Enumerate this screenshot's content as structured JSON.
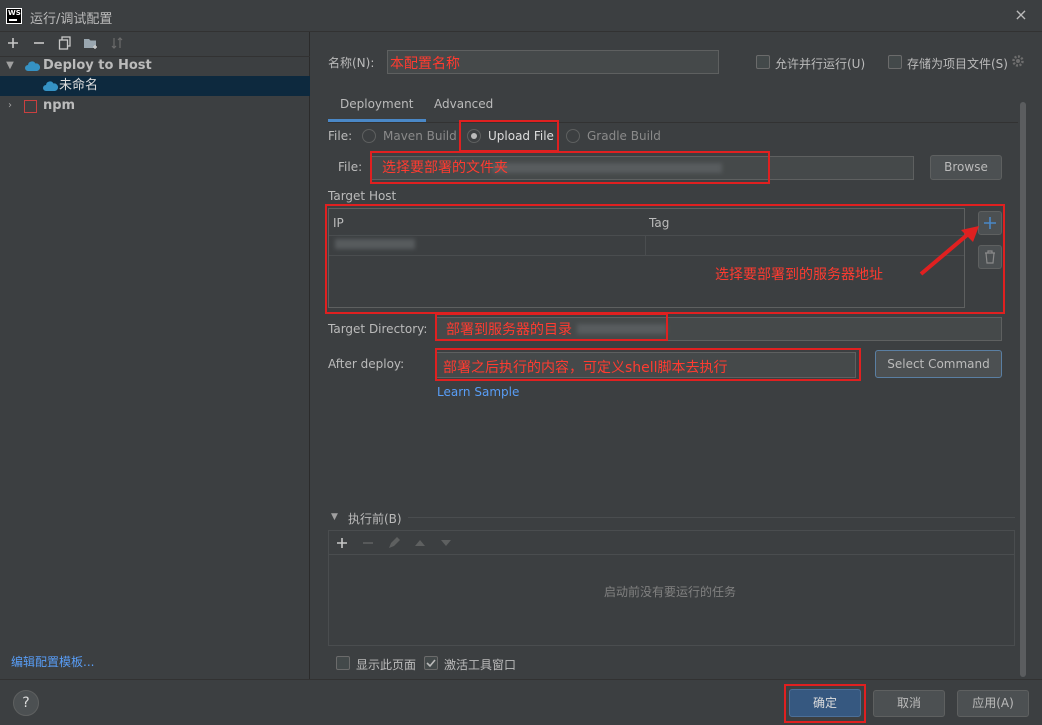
{
  "window": {
    "title": "运行/调试配置",
    "close_icon": "×"
  },
  "left_toolbar": {
    "icons": [
      "add-icon",
      "remove-icon",
      "copy-icon",
      "folder-add-icon",
      "sort-icon"
    ]
  },
  "tree": {
    "items": [
      {
        "label": "Deploy to Host",
        "expanded": true
      },
      {
        "label": "未命名",
        "selected": true
      },
      {
        "label": "npm",
        "expanded": false
      }
    ]
  },
  "left_footer": {
    "link": "编辑配置模板..."
  },
  "form": {
    "name_label": "名称(N):",
    "name_value": "本配置名称",
    "allow_parallel_label": "允许并行运行(U)",
    "store_as_file_label": "存储为项目文件(S)",
    "tabs": [
      "Deployment",
      "Advanced"
    ],
    "file_label": "File:",
    "file_options": [
      "Maven Build",
      "Upload File",
      "Gradle Build"
    ],
    "file_selected": "Upload File",
    "file_field_label": "File:",
    "file_field_value": "选择要部署的文件夹",
    "browse_label": "Browse",
    "target_host_label": "Target Host",
    "host_table": {
      "headers": [
        "IP",
        "Tag"
      ]
    },
    "host_annotation": "选择要部署到的服务器地址",
    "target_dir_label": "Target Directory:",
    "target_dir_value": "部署到服务器的目录",
    "after_deploy_label": "After deploy:",
    "after_deploy_value": "部署之后执行的内容，可定义shell脚本去执行",
    "select_command_label": "Select Command",
    "learn_sample_label": "Learn Sample",
    "before_launch_label": "执行前(B)",
    "before_launch_empty": "启动前没有要运行的任务",
    "show_page_label": "显示此页面",
    "activate_tool_label": "激活工具窗口",
    "show_page_checked": false,
    "activate_tool_checked": true
  },
  "footer": {
    "help_label": "?",
    "ok_label": "确定",
    "cancel_label": "取消",
    "apply_label": "应用(A)"
  },
  "colors": {
    "background": "#3c3f41",
    "annotation_red": "#e02020",
    "link_blue": "#589df6",
    "selection": "#0d293e",
    "primary_button": "#365880"
  }
}
